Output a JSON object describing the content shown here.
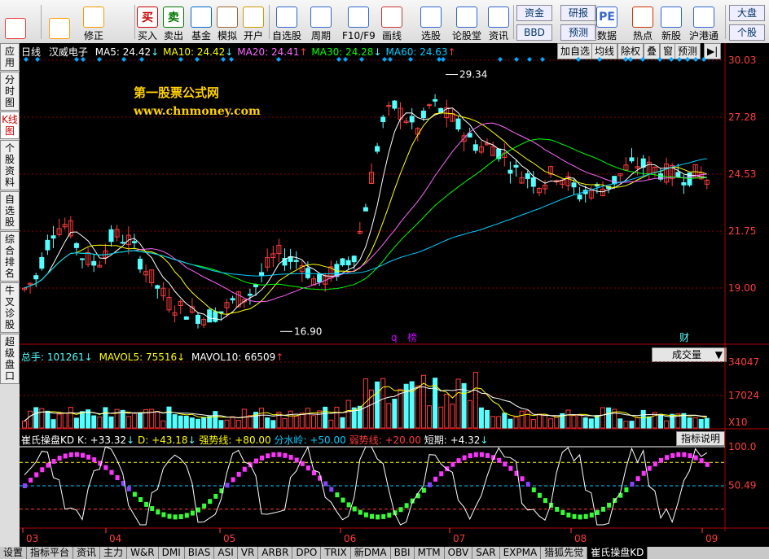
{
  "toolbar": {
    "buttons": [
      {
        "label": "",
        "icon": "grid-icon"
      },
      {
        "label": "",
        "icon": "back-arrow-icon"
      },
      {
        "label": "修正",
        "icon": "arrow-updown-icon"
      },
      {
        "label": "买入",
        "icon": "buy-icon",
        "glyph": "买"
      },
      {
        "label": "卖出",
        "icon": "sell-icon",
        "glyph": "卖"
      },
      {
        "label": "基金",
        "icon": "fund-icon"
      },
      {
        "label": "模拟",
        "icon": "hammer-icon"
      },
      {
        "label": "开户",
        "icon": "lock-icon"
      },
      {
        "label": "自选股",
        "icon": "star-icon"
      },
      {
        "label": "周期",
        "icon": "clock-icon"
      },
      {
        "label": "F10/F9",
        "icon": "f10-icon"
      },
      {
        "label": "画线",
        "icon": "pencil-icon"
      },
      {
        "label": "选股",
        "icon": "monitor-icon"
      },
      {
        "label": "论股堂",
        "icon": "forum-icon"
      },
      {
        "label": "资讯",
        "icon": "news-icon"
      },
      {
        "label": "数据",
        "icon": "pe-icon",
        "glyph": "PE"
      },
      {
        "label": "热点",
        "icon": "hot-icon"
      },
      {
        "label": "新股",
        "icon": "ipo-icon"
      },
      {
        "label": "沪港通",
        "icon": "hk-connect-icon"
      }
    ],
    "small_buttons": {
      "zijin": "资金",
      "bbd": "BBD",
      "yanbao": "研报",
      "yuce": "预测",
      "dapan": "大盘",
      "gegu": "个股"
    }
  },
  "sidebar": {
    "tabs": [
      "应用",
      "分时图",
      "K线图",
      "个股资料",
      "自选股",
      "综合排名",
      "牛叉诊股",
      "超级盘口"
    ]
  },
  "kline": {
    "period": "日线",
    "stock_name": "汉威电子",
    "ma": [
      {
        "label": "MA5: 24.42",
        "arrow": "↓",
        "color": "#ffffff"
      },
      {
        "label": "MA10: 24.42",
        "arrow": "↓",
        "color": "#ffff00"
      },
      {
        "label": "MA20: 24.41",
        "arrow": "↑",
        "color": "#ff66ff"
      },
      {
        "label": "MA30: 24.28",
        "arrow": "↓",
        "color": "#00ff00"
      },
      {
        "label": "MA60: 24.63",
        "arrow": "↑",
        "color": "#00ccff"
      }
    ],
    "buttons": [
      "加自选",
      "均线",
      "除权",
      "叠",
      "窗",
      "预测"
    ],
    "y_ticks": [
      "30.03",
      "27.28",
      "24.53",
      "21.75",
      "19.00"
    ],
    "high_label": "29.34",
    "low_label": "16.90",
    "markers": {
      "q": "q",
      "bang": "榜",
      "cai": "财"
    },
    "watermark_title": "第一股票公式网",
    "watermark_url": "www.chnmoney.com"
  },
  "volume": {
    "total_label": "总手: 101261",
    "total_arrow": "↓",
    "mavol5": "MAVOL5: 75516",
    "mavol5_arrow": "↓",
    "mavol10": "MAVOL10: 66509",
    "mavol10_arrow": "↑",
    "selector": "成交量",
    "y_ticks": [
      "34047",
      "17024"
    ],
    "unit": "X10"
  },
  "indicator": {
    "name": "崔氏操盘KD",
    "k": "K: +33.32",
    "k_arrow": "↓",
    "d": "D: +43.18",
    "d_arrow": "↓",
    "strong": "强势线: +80.00",
    "water": "分水岭: +50.00",
    "weak": "弱势线: +20.00",
    "short": "短期: +4.32",
    "short_arrow": "↓",
    "help_button": "指标说明",
    "y_ticks": [
      "100.0",
      "50.49"
    ]
  },
  "x_axis": [
    "03",
    "04",
    "05",
    "06",
    "07",
    "08",
    "09"
  ],
  "bottom_tabs": [
    "设置",
    "指标平台",
    "资讯",
    "主力",
    "W&R",
    "DMI",
    "BIAS",
    "ASI",
    "VR",
    "ARBR",
    "DPO",
    "TRIX",
    "新DMA",
    "BBI",
    "MTM",
    "OBV",
    "SAR",
    "EXPMA",
    "猎狐先觉",
    "崔氏操盘KD"
  ],
  "colors": {
    "up": "#ff3c3c",
    "down": "#54ffff",
    "grid": "#8b0000",
    "axis": "#b00000"
  }
}
